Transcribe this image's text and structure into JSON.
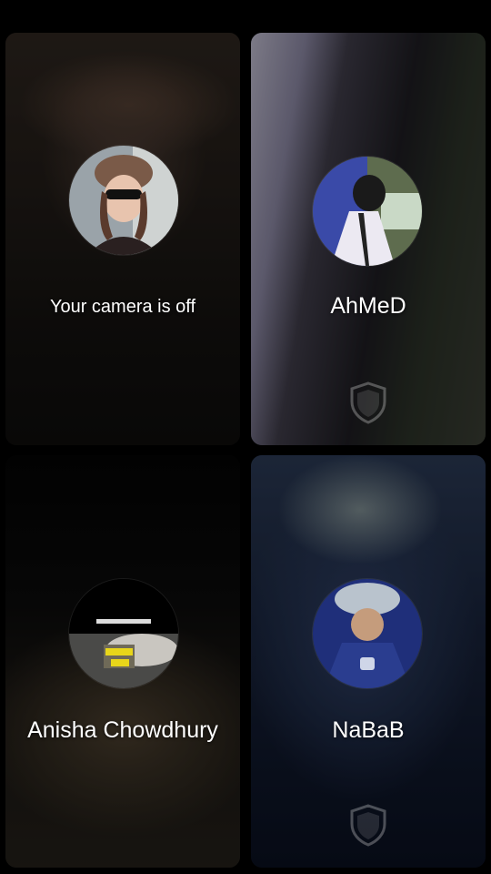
{
  "tiles": [
    {
      "label": "Your camera is off",
      "avatar_icon": "user-photo-woman-hat",
      "shield_visible": false
    },
    {
      "label": "AhMeD",
      "avatar_icon": "user-photo-man",
      "shield_visible": true
    },
    {
      "label": "Anisha Chowdhury",
      "avatar_icon": "user-photo-anisha",
      "shield_visible": false
    },
    {
      "label": "NaBaB",
      "avatar_icon": "user-photo-nabab",
      "shield_visible": true
    }
  ],
  "colors": {
    "background": "#000000",
    "text": "#ffffff"
  }
}
